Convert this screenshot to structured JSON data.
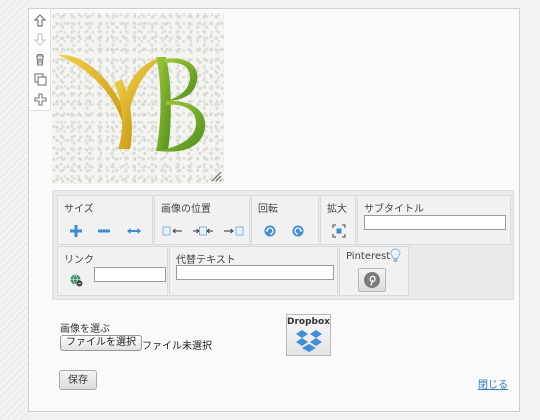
{
  "toolbar": {
    "size": {
      "label": "サイズ",
      "icons": [
        "plus-icon",
        "minus-icon",
        "fit-width-icon"
      ]
    },
    "position": {
      "label": "画像の位置",
      "icons": [
        "align-left-icon",
        "align-center-icon",
        "align-right-icon"
      ]
    },
    "rotate": {
      "label": "回転",
      "icons": [
        "rotate-left-icon",
        "rotate-right-icon"
      ]
    },
    "zoom": {
      "label": "拡大",
      "icon": "zoom-icon"
    },
    "subtitle": {
      "label": "サブタイトル",
      "value": ""
    },
    "link": {
      "label": "リンク",
      "value": "",
      "icon": "link-globe-icon"
    },
    "alt": {
      "label": "代替テキスト",
      "value": ""
    },
    "pinterest": {
      "label": "Pinterest",
      "icon": "pinterest-icon",
      "hint_icon": "lightbulb-icon"
    }
  },
  "sidebar": {
    "icons": [
      "move-up-icon",
      "move-down-icon",
      "trash-icon",
      "copy-icon",
      "add-icon"
    ]
  },
  "image": {
    "logo_text": "YB"
  },
  "file": {
    "choose_label": "画像を選ぶ",
    "button_label": "ファイルを選択",
    "status": "ファイル未選択"
  },
  "dropbox": {
    "label": "Dropbox"
  },
  "actions": {
    "save_label": "保存",
    "close_label": "閉じる"
  },
  "colors": {
    "accent": "#2a7ab8",
    "logo_gold": "#e3b21c",
    "logo_green": "#6fa526"
  }
}
